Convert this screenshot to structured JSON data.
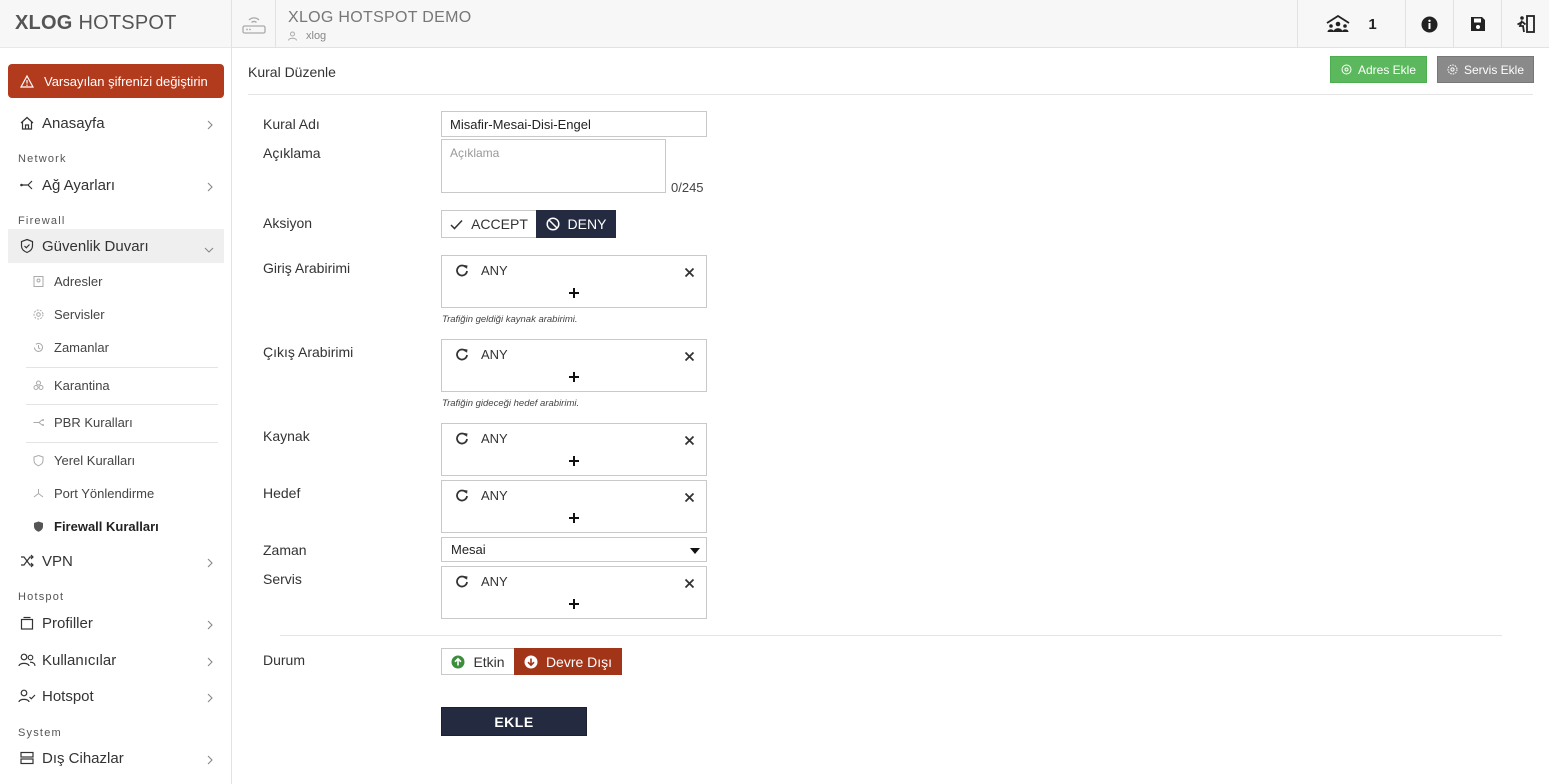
{
  "brand": {
    "bold": "XLOG",
    "light": "HOTSPOT"
  },
  "alert": {
    "text": "Varsayılan şifrenizi değiştirin"
  },
  "sidebar": {
    "home": "Anasayfa",
    "sections": {
      "network": "Network",
      "firewall": "Firewall",
      "hotspot": "Hotspot",
      "system": "System"
    },
    "network_settings": "Ağ Ayarları",
    "firewall": "Güvenlik Duvarı",
    "firewall_items": {
      "addresses": "Adresler",
      "services": "Servisler",
      "schedules": "Zamanlar",
      "quarantine": "Karantina",
      "pbr": "PBR Kuralları",
      "local_rules": "Yerel Kuralları",
      "port_forward": "Port Yönlendirme",
      "firewall_rules": "Firewall Kuralları"
    },
    "vpn": "VPN",
    "profiles": "Profiller",
    "users": "Kullanıcılar",
    "hotspot": "Hotspot",
    "external_devices": "Dış Cihazlar"
  },
  "topbar": {
    "title": "XLOG HOTSPOT DEMO",
    "subtitle": "xlog",
    "online_count": "1"
  },
  "page": {
    "title": "Kural Düzenle",
    "add_address": "Adres Ekle",
    "add_service": "Servis Ekle"
  },
  "form": {
    "rule_name_label": "Kural Adı",
    "rule_name_value": "Misafir-Mesai-Disi-Engel",
    "description_label": "Açıklama",
    "description_placeholder": "Açıklama",
    "description_counter": "0/245",
    "action_label": "Aksiyon",
    "action_accept": "ACCEPT",
    "action_deny": "DENY",
    "in_iface_label": "Giriş Arabirimi",
    "in_iface_value": "ANY",
    "in_iface_hint": "Trafiğin geldiği kaynak arabirimi.",
    "out_iface_label": "Çıkış Arabirimi",
    "out_iface_value": "ANY",
    "out_iface_hint": "Trafiğin gideceği hedef arabirimi.",
    "source_label": "Kaynak",
    "source_value": "ANY",
    "dest_label": "Hedef",
    "dest_value": "ANY",
    "time_label": "Zaman",
    "time_value": "Mesai",
    "service_label": "Servis",
    "service_value": "ANY",
    "status_label": "Durum",
    "status_enabled": "Etkin",
    "status_disabled": "Devre Dışı",
    "submit": "EKLE"
  },
  "colors": {
    "alert_bg": "#b23b1e",
    "deny_active": "#242a3f",
    "disabled_active": "#a23418",
    "add_address_btn": "#5cb85c",
    "add_service_btn": "#8a8a8a"
  }
}
